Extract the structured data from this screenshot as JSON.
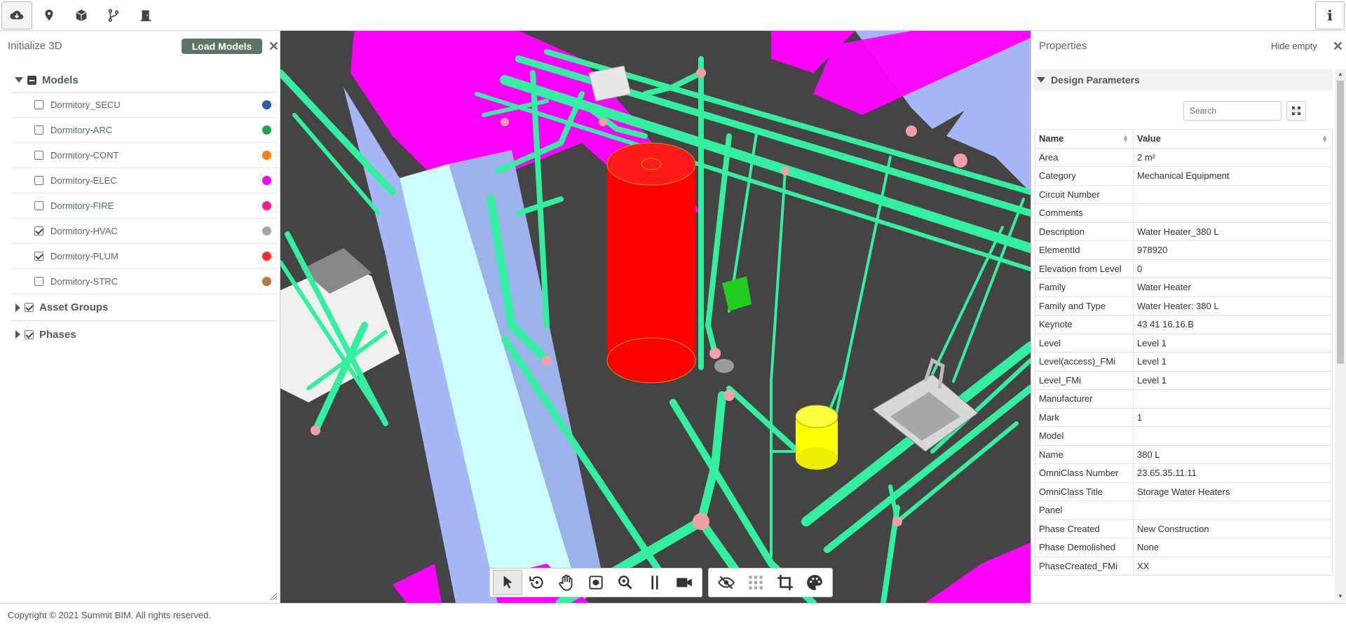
{
  "topbar": {
    "buttons": [
      "cloud-download-icon",
      "map-marker-icon",
      "cube-icon",
      "branch-icon",
      "door-icon"
    ],
    "info_label": "i"
  },
  "left_panel": {
    "title": "Initialize 3D",
    "load_button": "Load Models",
    "close": "✕",
    "models": {
      "label": "Models",
      "items": [
        {
          "label": "Dormitory_SECU",
          "checked": false,
          "color": "#2d5aa8"
        },
        {
          "label": "Dormitory-ARC",
          "checked": false,
          "color": "#22a14a"
        },
        {
          "label": "Dormitory-CONT",
          "checked": false,
          "color": "#ff7f0e"
        },
        {
          "label": "Dormitory-ELEC",
          "checked": false,
          "color": "#ff00ff"
        },
        {
          "label": "Dormitory-FIRE",
          "checked": false,
          "color": "#ff1a8c"
        },
        {
          "label": "Dormitory-HVAC",
          "checked": true,
          "color": "#a6a6a6"
        },
        {
          "label": "Dormitory-PLUM",
          "checked": true,
          "color": "#ff2a2a"
        },
        {
          "label": "Dormitory-STRC",
          "checked": false,
          "color": "#b8793a"
        }
      ]
    },
    "asset_groups": "Asset Groups",
    "phases": "Phases"
  },
  "toolbar": {
    "group1": [
      "select-icon",
      "orbit-icon",
      "pan-icon",
      "fit-view-icon",
      "zoom-icon",
      "walk-icon",
      "camera-icon"
    ],
    "group2": [
      "hide-icon",
      "section-box-icon",
      "crop-icon",
      "palette-icon"
    ]
  },
  "right_panel": {
    "title": "Properties",
    "hide_empty": "Hide empty",
    "close": "✕",
    "section": "Design Parameters",
    "search_placeholder": "Search",
    "col_name": "Name",
    "col_value": "Value",
    "rows": [
      {
        "name": "Area",
        "value": "2 m²"
      },
      {
        "name": "Category",
        "value": "Mechanical Equipment"
      },
      {
        "name": "Circuit Number",
        "value": ""
      },
      {
        "name": "Comments",
        "value": ""
      },
      {
        "name": "Description",
        "value": "Water Heater_380 L"
      },
      {
        "name": "ElementId",
        "value": "978920"
      },
      {
        "name": "Elevation from Level",
        "value": "0"
      },
      {
        "name": "Family",
        "value": "Water Heater"
      },
      {
        "name": "Family and Type",
        "value": "Water Heater: 380 L"
      },
      {
        "name": "Keynote",
        "value": "43 41 16.16.B"
      },
      {
        "name": "Level",
        "value": "Level 1"
      },
      {
        "name": "Level(access)_FMi",
        "value": "Level 1"
      },
      {
        "name": "Level_FMi",
        "value": "Level 1"
      },
      {
        "name": "Manufacturer",
        "value": ""
      },
      {
        "name": "Mark",
        "value": "1"
      },
      {
        "name": "Model",
        "value": ""
      },
      {
        "name": "Name",
        "value": "380 L"
      },
      {
        "name": "OmniClass Number",
        "value": "23.65.35.11.11"
      },
      {
        "name": "OmniClass Title",
        "value": "Storage Water Heaters"
      },
      {
        "name": "Panel",
        "value": ""
      },
      {
        "name": "Phase Created",
        "value": "New Construction"
      },
      {
        "name": "Phase Demolished",
        "value": "None"
      },
      {
        "name": "PhaseCreated_FMi",
        "value": "XX"
      }
    ]
  },
  "footer": {
    "copyright": "Copyright © 2021 Summit BIM. All rights reserved."
  }
}
